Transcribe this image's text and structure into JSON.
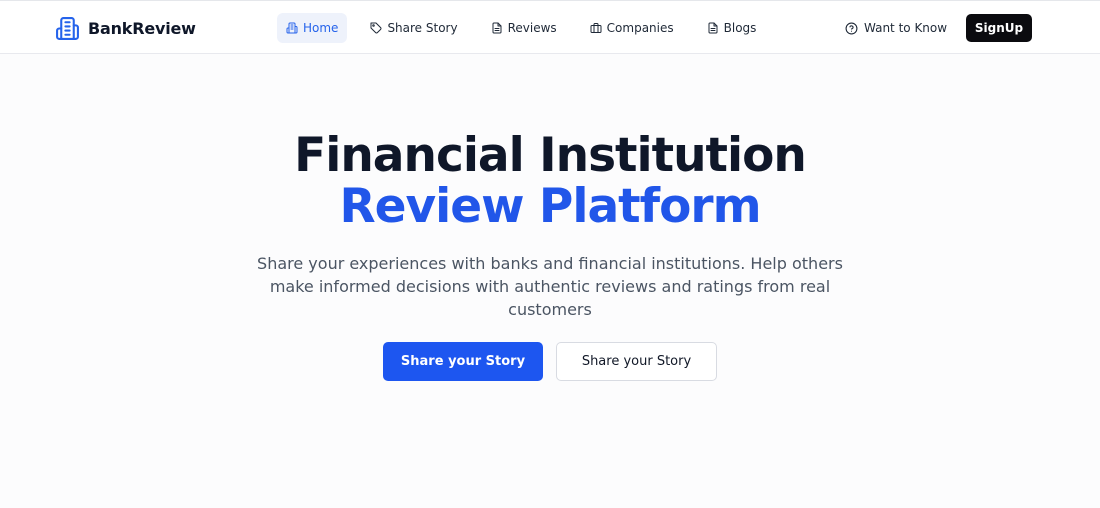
{
  "brand": {
    "name": "BankReview",
    "icon": "building-icon",
    "color": "#2563eb"
  },
  "nav": {
    "items": [
      {
        "label": "Home",
        "icon": "building-icon",
        "active": true
      },
      {
        "label": "Share Story",
        "icon": "tag-icon",
        "active": false
      },
      {
        "label": "Reviews",
        "icon": "document-icon",
        "active": false
      },
      {
        "label": "Companies",
        "icon": "briefcase-icon",
        "active": false
      },
      {
        "label": "Blogs",
        "icon": "document-icon",
        "active": false
      }
    ]
  },
  "header_actions": {
    "want_label": "Want to Know",
    "want_icon": "help-circle-icon",
    "signup_label": "SignUp"
  },
  "hero": {
    "title_line1": "Financial Institution",
    "title_line2": "Review Platform",
    "subtitle": "Share your experiences with banks and financial institutions. Help others make informed decisions with authentic reviews and ratings from real customers",
    "primary_button": "Share your Story",
    "secondary_button": "Share your Story"
  },
  "colors": {
    "accent": "#2156e9",
    "signup_bg": "#0b0b0f",
    "active_nav_bg": "#eef2fb"
  }
}
